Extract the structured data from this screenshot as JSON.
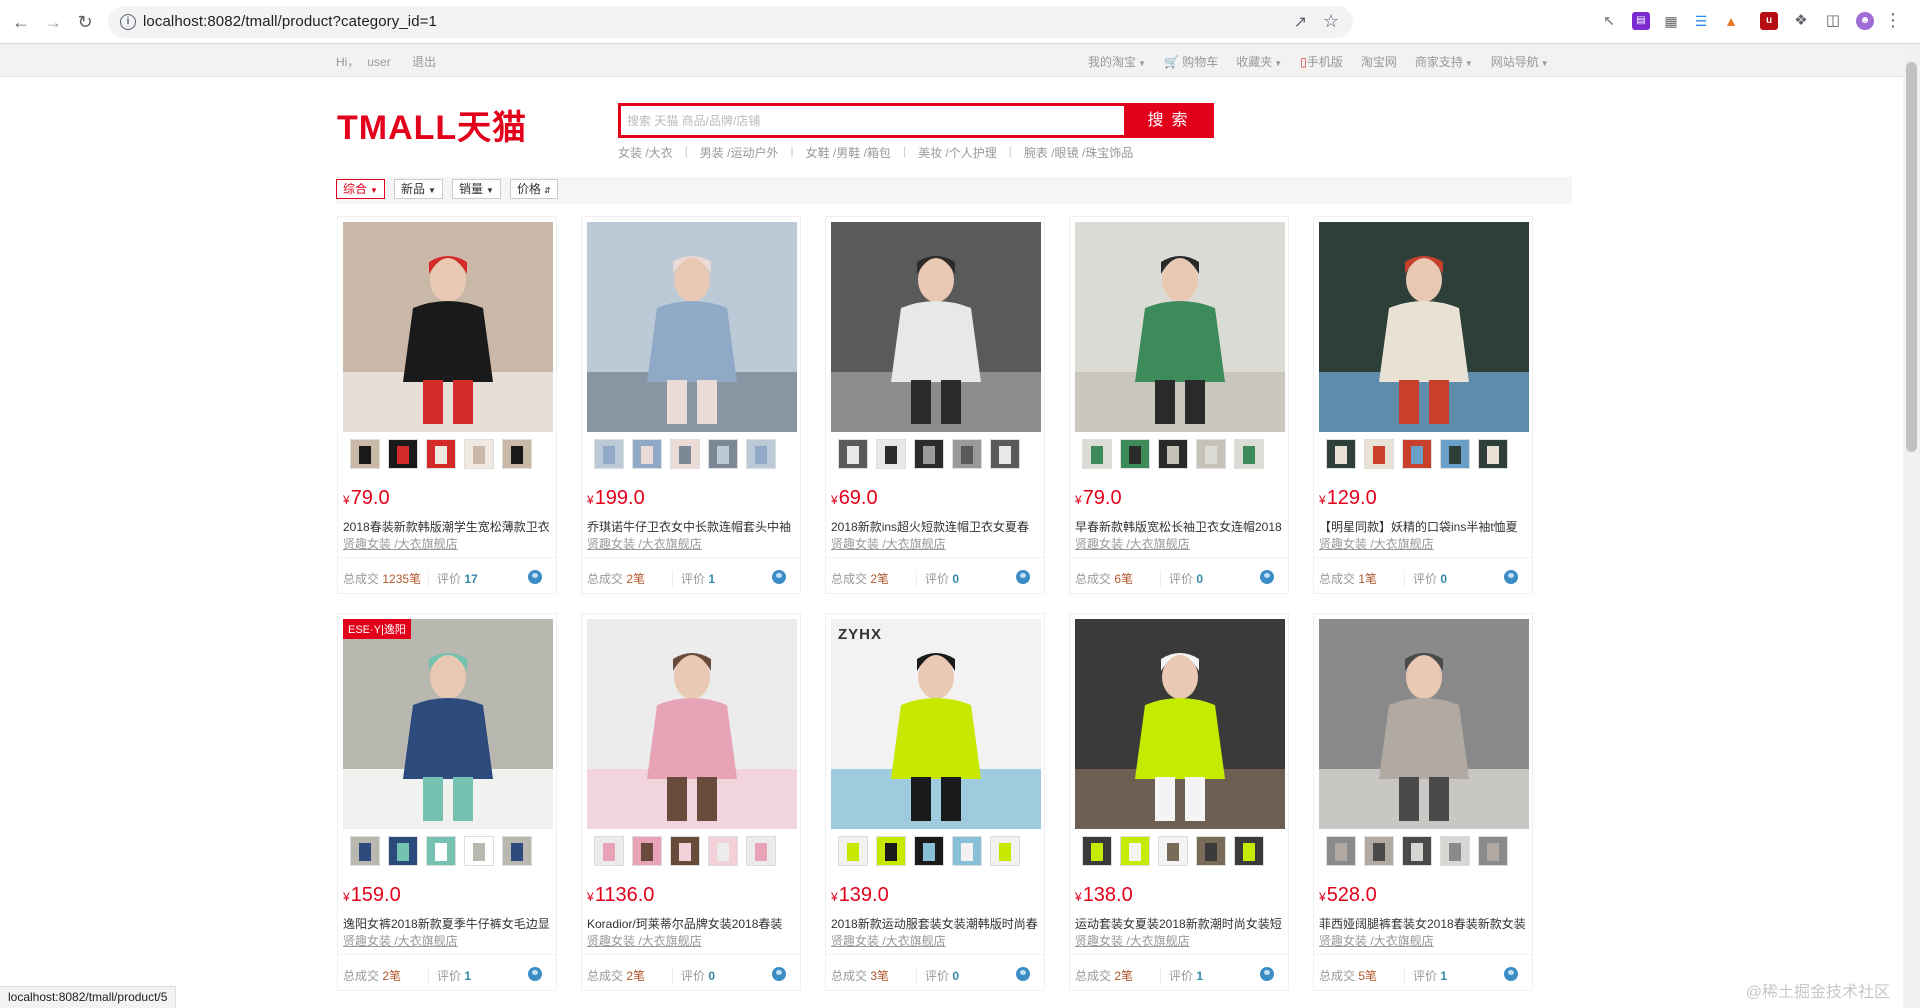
{
  "browser": {
    "url": "localhost:8082/tmall/product?category_id=1",
    "status_url": "localhost:8082/tmall/product/5"
  },
  "site_top": {
    "greeting": "Hi，",
    "user": "user",
    "logout": "退出",
    "links": [
      "我的淘宝",
      "购物车",
      "收藏夹",
      "手机版",
      "淘宝网",
      "商家支持",
      "网站导航"
    ]
  },
  "header": {
    "logo": "TMALL天猫",
    "search_placeholder": "搜索 天猫 商品/品牌/店铺",
    "search_button": "搜索",
    "hot_words": [
      "女装 /大衣",
      "男装 /运动户外",
      "女鞋 /男鞋 /箱包",
      "美妆 /个人护理",
      "腕表 /眼镜 /珠宝饰品"
    ]
  },
  "sort": [
    "综合",
    "新品",
    "销量",
    "价格"
  ],
  "colors": {
    "brand_red": "#e3001b",
    "count_brown": "#b0562b",
    "review_blue": "#3388aa"
  },
  "products": [
    {
      "price": "79.0",
      "title": "2018春装新款韩版潮学生宽松薄款卫衣",
      "shop": "贤趣女装 /大衣旗舰店",
      "deal_label": "总成交",
      "deal": "1235笔",
      "review_label": "评价",
      "reviews": "17",
      "palette": [
        "#c9b8a8",
        "#1a1a1a",
        "#d42a2a",
        "#efe9e2"
      ]
    },
    {
      "price": "199.0",
      "title": "乔琪诺牛仔卫衣女中长款连帽套头中袖",
      "shop": "贤趣女装 /大衣旗舰店",
      "deal_label": "总成交",
      "deal": "2笔",
      "review_label": "评价",
      "reviews": "1",
      "palette": [
        "#bcc9d6",
        "#8fa9c6",
        "#eadbd6",
        "#7d8896"
      ]
    },
    {
      "price": "69.0",
      "title": "2018新款ins超火短款连帽卫衣女夏春",
      "shop": "贤趣女装 /大衣旗舰店",
      "deal_label": "总成交",
      "deal": "2笔",
      "review_label": "评价",
      "reviews": "0",
      "palette": [
        "#5a5a5a",
        "#e8e8e8",
        "#2b2b2b",
        "#9a9a9a"
      ]
    },
    {
      "price": "79.0",
      "title": "早春新款韩版宽松长袖卫衣女连帽2018",
      "shop": "贤趣女装 /大衣旗舰店",
      "deal_label": "总成交",
      "deal": "6笔",
      "review_label": "评价",
      "reviews": "0",
      "palette": [
        "#dcdcd6",
        "#3d8a5b",
        "#2a2a2a",
        "#c7c2b8"
      ]
    },
    {
      "price": "129.0",
      "title": "【明星同款】妖精的口袋ins半袖t恤夏",
      "shop": "贤趣女装 /大衣旗舰店",
      "deal_label": "总成交",
      "deal": "1笔",
      "review_label": "评价",
      "reviews": "0",
      "palette": [
        "#2e3f3a",
        "#e8e2d4",
        "#c8402c",
        "#6aa0c8"
      ]
    },
    {
      "price": "159.0",
      "title": "逸阳女裤2018新款夏季牛仔裤女毛边显",
      "shop": "贤趣女装 /大衣旗舰店",
      "deal_label": "总成交",
      "deal": "2笔",
      "review_label": "评价",
      "reviews": "1",
      "palette": [
        "#b8b8b0",
        "#2c4a7c",
        "#76c2b0",
        "#ffffff"
      ]
    },
    {
      "price": "1136.0",
      "title": "Koradior/珂莱蒂尔品牌女装2018春装",
      "shop": "贤趣女装 /大衣旗舰店",
      "deal_label": "总成交",
      "deal": "2笔",
      "review_label": "评价",
      "reviews": "0",
      "palette": [
        "#ececec",
        "#e6a4b6",
        "#6a4a3a",
        "#f4d0d8"
      ]
    },
    {
      "price": "139.0",
      "title": "2018新款运动服套装女装潮韩版时尚春",
      "shop": "贤趣女装 /大衣旗舰店",
      "deal_label": "总成交",
      "deal": "3笔",
      "review_label": "评价",
      "reviews": "0",
      "palette": [
        "#f2f2f2",
        "#c8e800",
        "#1a1a1a",
        "#88c0d8"
      ],
      "badge": "ZYHX"
    },
    {
      "price": "138.0",
      "title": "运动套装女夏装2018新款潮时尚女装短",
      "shop": "贤趣女装 /大衣旗舰店",
      "deal_label": "总成交",
      "deal": "2笔",
      "review_label": "评价",
      "reviews": "1",
      "palette": [
        "#3a3a3a",
        "#c4ec00",
        "#f4f4f4",
        "#7a6a5a"
      ]
    },
    {
      "price": "528.0",
      "title": "菲西娅阔腿裤套装女2018春装新款女装",
      "shop": "贤趣女装 /大衣旗舰店",
      "deal_label": "总成交",
      "deal": "5笔",
      "review_label": "评价",
      "reviews": "1",
      "palette": [
        "#8a8a8a",
        "#b0aaa2",
        "#4a4a4a",
        "#d8d6d2"
      ]
    }
  ],
  "card1_badge": "ESE·Y|逸阳",
  "watermark": "@稀土掘金技术社区"
}
